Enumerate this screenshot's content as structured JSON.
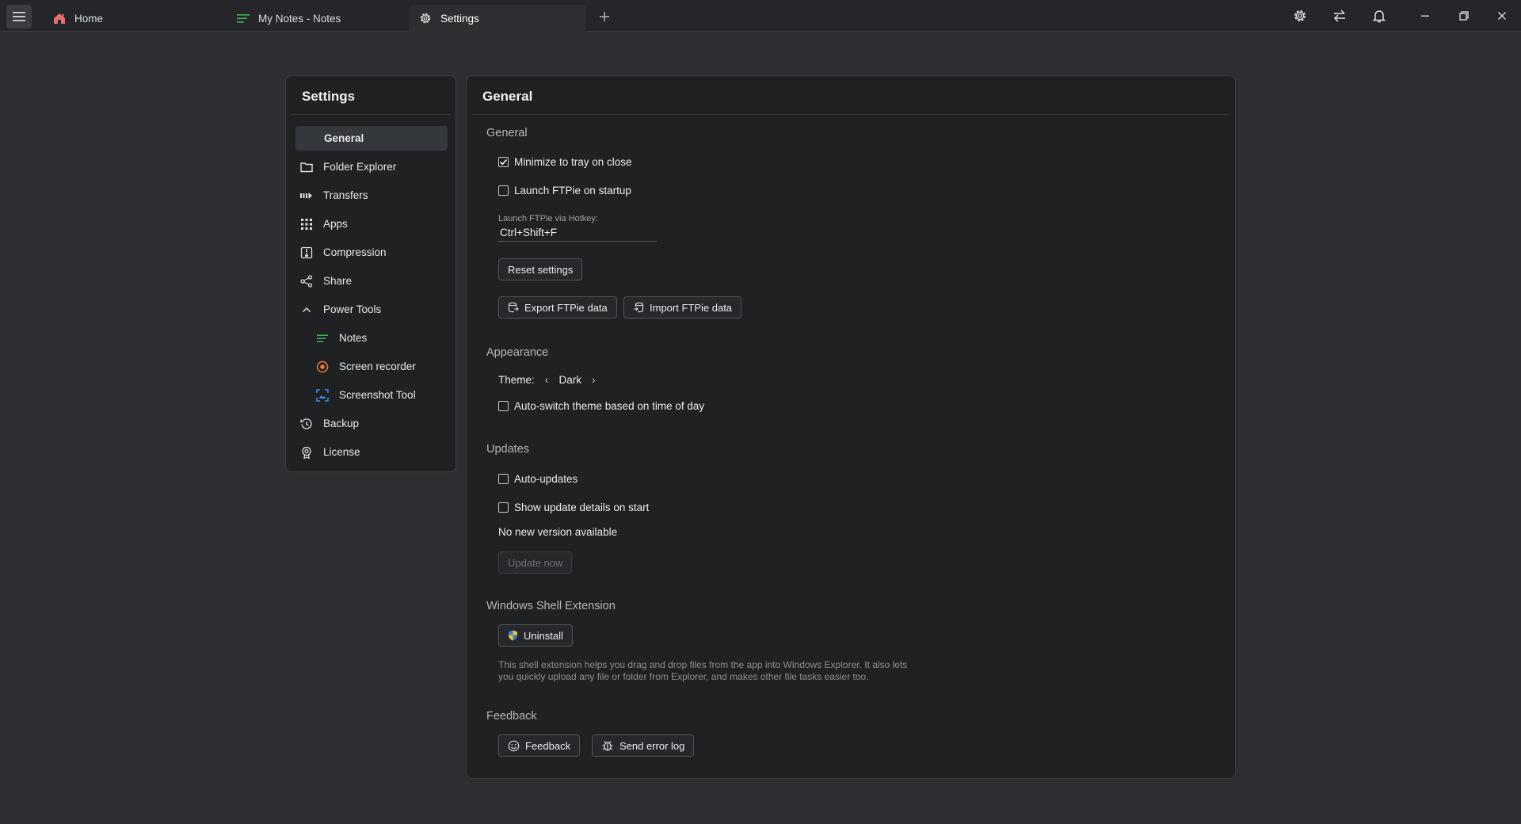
{
  "titlebar": {
    "tabs": [
      {
        "label": "Home",
        "icon": "home-icon"
      },
      {
        "label": "My Notes - Notes",
        "icon": "notes-icon"
      },
      {
        "label": "Settings",
        "icon": "gear-icon"
      }
    ],
    "accent_notes": "#3fb950",
    "accent_home": "#e8706a"
  },
  "nav": {
    "title": "Settings",
    "items": [
      {
        "label": "General",
        "icon": ""
      },
      {
        "label": "Folder Explorer",
        "icon": "folder-icon"
      },
      {
        "label": "Transfers",
        "icon": "transfers-icon"
      },
      {
        "label": "Apps",
        "icon": "apps-grid-icon"
      },
      {
        "label": "Compression",
        "icon": "compression-icon"
      },
      {
        "label": "Share",
        "icon": "share-icon"
      },
      {
        "label": "Power Tools",
        "icon": "chevron-up-icon"
      },
      {
        "label": "Notes",
        "icon": "notes-icon"
      },
      {
        "label": "Screen recorder",
        "icon": "record-icon"
      },
      {
        "label": "Screenshot Tool",
        "icon": "screenshot-icon"
      },
      {
        "label": "Backup",
        "icon": "backup-icon"
      },
      {
        "label": "License",
        "icon": "license-icon"
      }
    ]
  },
  "main": {
    "title": "General",
    "general": {
      "heading": "General",
      "minimize_to_tray": {
        "label": "Minimize to tray on close",
        "checked": true
      },
      "launch_on_startup": {
        "label": "Launch FTPie on startup",
        "checked": false
      },
      "hotkey_label": "Launch FTPie via Hotkey:",
      "hotkey_value": "Ctrl+Shift+F",
      "reset_label": "Reset settings",
      "export_label": "Export FTPie data",
      "import_label": "Import FTPie data"
    },
    "appearance": {
      "heading": "Appearance",
      "theme_label": "Theme:",
      "theme_value": "Dark",
      "auto_switch": {
        "label": "Auto-switch theme based on time of day",
        "checked": false
      }
    },
    "updates": {
      "heading": "Updates",
      "auto_updates": {
        "label": "Auto-updates",
        "checked": false
      },
      "show_details": {
        "label": "Show update details on start",
        "checked": false
      },
      "status": "No new version available",
      "update_now_label": "Update now"
    },
    "shell": {
      "heading": "Windows Shell Extension",
      "uninstall_label": "Uninstall",
      "description": "This shell extension helps you drag and drop files from the app into Windows Explorer. It also lets you quickly upload any file or folder from Explorer, and makes other file tasks easier too."
    },
    "feedback": {
      "heading": "Feedback",
      "feedback_label": "Feedback",
      "error_log_label": "Send error log"
    }
  }
}
